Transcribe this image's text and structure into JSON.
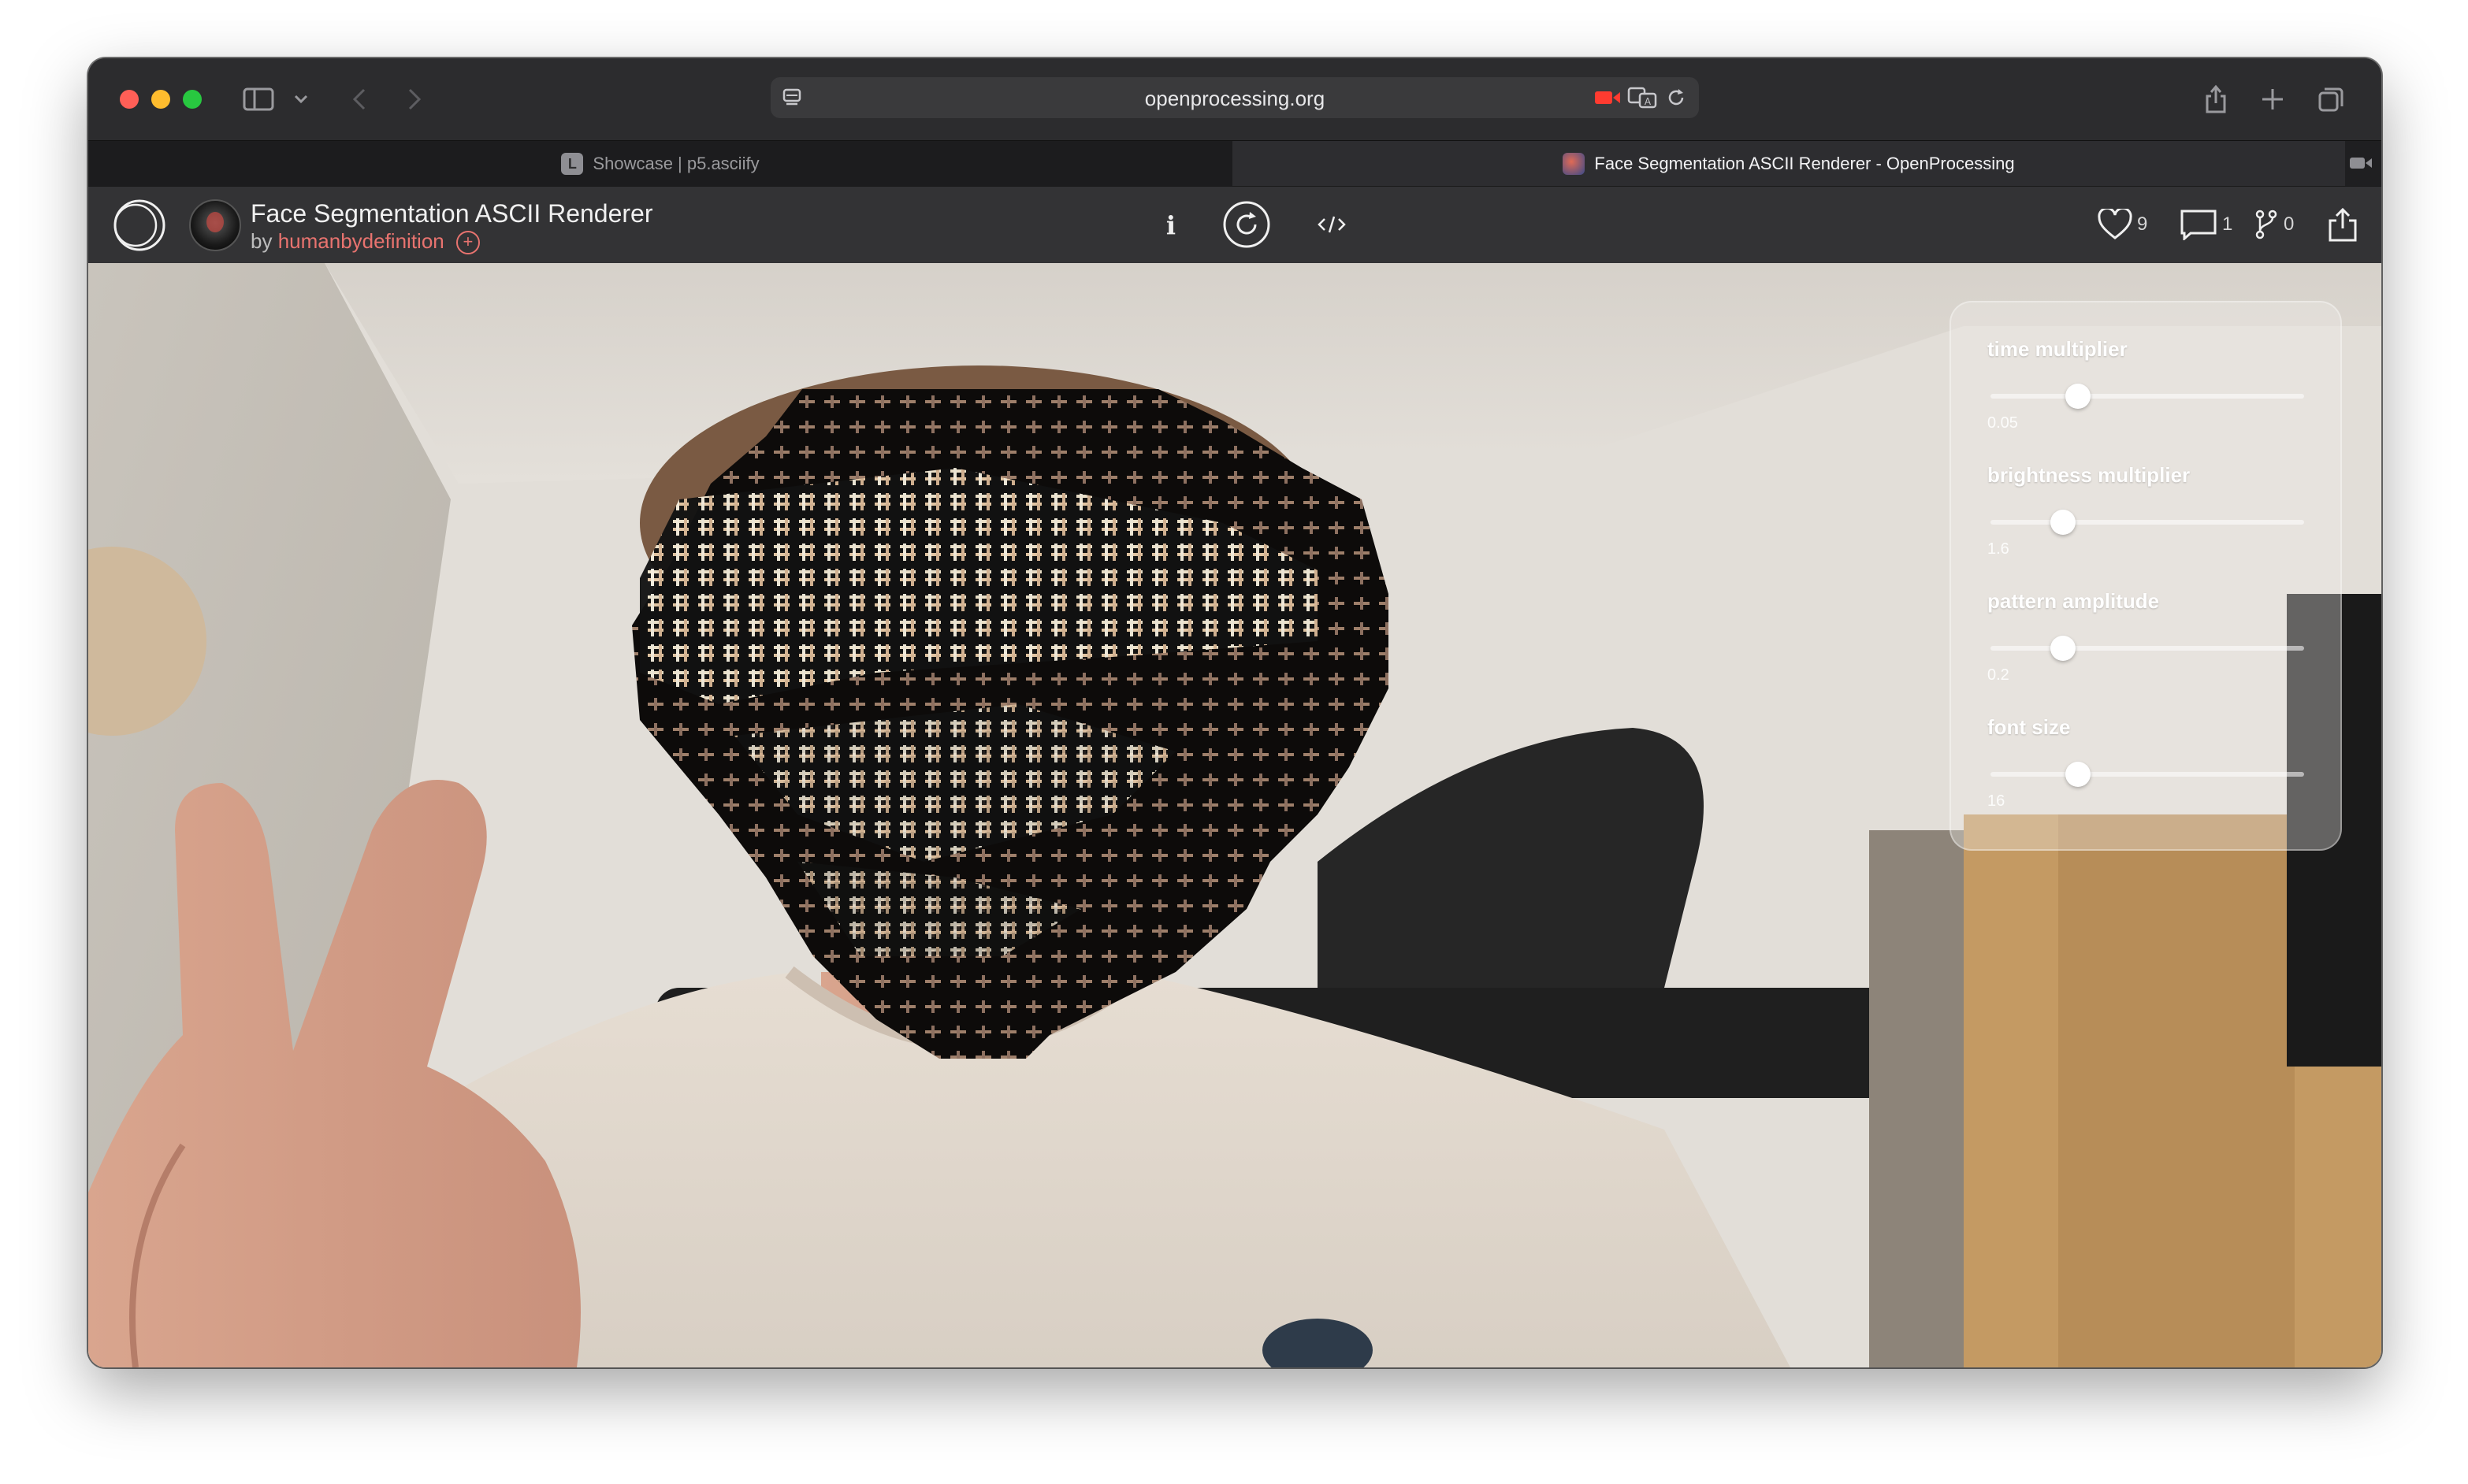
{
  "browser": {
    "url": "openprocessing.org",
    "tabs": [
      {
        "label": "Showcase | p5.asciify",
        "favicon_letter": "L",
        "active": false
      },
      {
        "label": "Face Segmentation ASCII Renderer - OpenProcessing",
        "active": true
      }
    ]
  },
  "sketch": {
    "title": "Face Segmentation ASCII Renderer",
    "by_prefix": "by",
    "author": "humanbydefinition",
    "likes": "9",
    "comments": "1",
    "forks": "0"
  },
  "controls": [
    {
      "label": "time multiplier",
      "value": "0.05",
      "position": 0.28
    },
    {
      "label": "brightness multiplier",
      "value": "1.6",
      "position": 0.23
    },
    {
      "label": "pattern amplitude",
      "value": "0.2",
      "position": 0.23
    },
    {
      "label": "font size",
      "value": "16",
      "position": 0.28
    }
  ],
  "colors": {
    "accent_author": "#e8736f",
    "traffic_red": "#ff5f57",
    "traffic_yellow": "#febc2e",
    "traffic_green": "#28c840"
  }
}
